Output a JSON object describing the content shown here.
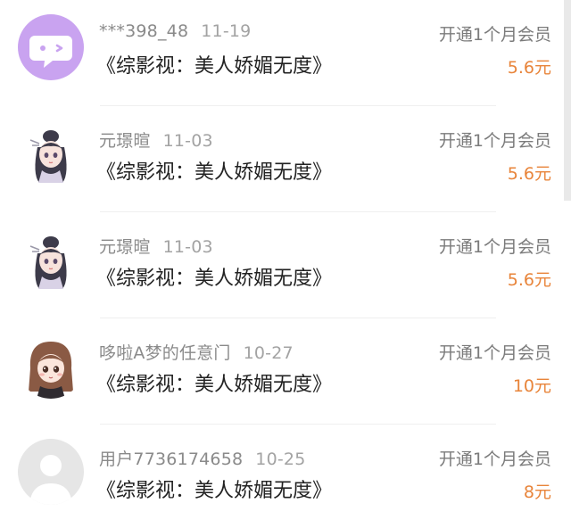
{
  "records": [
    {
      "user": "***398_48",
      "date": "11-19",
      "action": "开通1个月会员",
      "title": "《综影视：美人娇媚无度》",
      "price": "5.6元",
      "avatar": "chat-bubble-icon"
    },
    {
      "user": "元璟暄",
      "date": "11-03",
      "action": "开通1个月会员",
      "title": "《综影视：美人娇媚无度》",
      "price": "5.6元",
      "avatar": "anime-girl-avatar"
    },
    {
      "user": "元璟暄",
      "date": "11-03",
      "action": "开通1个月会员",
      "title": "《综影视：美人娇媚无度》",
      "price": "5.6元",
      "avatar": "anime-girl-avatar"
    },
    {
      "user": "哆啦A梦的任意门",
      "date": "10-27",
      "action": "开通1个月会员",
      "title": "《综影视：美人娇媚无度》",
      "price": "10元",
      "avatar": "chibi-girl-avatar"
    },
    {
      "user": "用户7736174658",
      "date": "10-25",
      "action": "开通1个月会员",
      "title": "《综影视：美人娇媚无度》",
      "price": "8元",
      "avatar": "default-user-avatar"
    }
  ],
  "colors": {
    "price": "#e8843a",
    "avatar_purple": "#c9a3f0",
    "avatar_default": "#e6e6e6"
  }
}
